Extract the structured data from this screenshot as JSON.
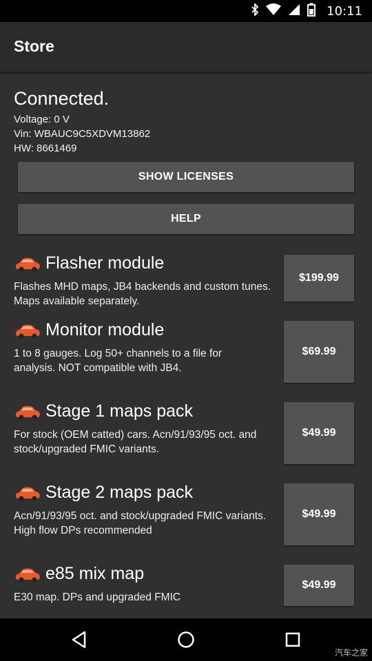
{
  "status_bar": {
    "time": "10:11",
    "icons": [
      "bluetooth-icon",
      "wifi-icon",
      "cell-signal-icon",
      "battery-icon"
    ]
  },
  "app_bar": {
    "title": "Store"
  },
  "connection": {
    "status": "Connected.",
    "voltage": "Voltage: 0 V",
    "vin": "Vin: WBAUC9C5XDVM13862",
    "hw": "HW: 8661469"
  },
  "buttons": {
    "show_licenses": "SHOW LICENSES",
    "help": "HELP"
  },
  "products": [
    {
      "title": "Flasher module",
      "desc": "Flashes MHD maps, JB4 backends and custom tunes. Maps available separately.",
      "price": "$199.99"
    },
    {
      "title": "Monitor module",
      "desc": "1 to 8 gauges. Log 50+ channels to a file for analysis. NOT compatible with JB4.",
      "price": "$69.99"
    },
    {
      "title": "Stage 1 maps pack",
      "desc": "For stock (OEM catted) cars. Acn/91/93/95 oct. and stock/upgraded FMIC variants.",
      "price": "$49.99"
    },
    {
      "title": "Stage 2 maps pack",
      "desc": "Acn/91/93/95 oct. and stock/upgraded FMIC variants. High flow DPs recommended",
      "price": "$49.99"
    },
    {
      "title": "e85 mix map",
      "desc": "E30 map. DPs and upgraded FMIC",
      "price": "$49.99"
    }
  ],
  "nav_bar": {
    "icons": [
      "back-icon",
      "home-icon",
      "recents-icon"
    ]
  },
  "watermark": "汽车之家",
  "colors": {
    "app_bar": "#2b2b2b",
    "content_bg": "#303030",
    "button_bg": "#535353",
    "car_icon": "#e8592b"
  }
}
